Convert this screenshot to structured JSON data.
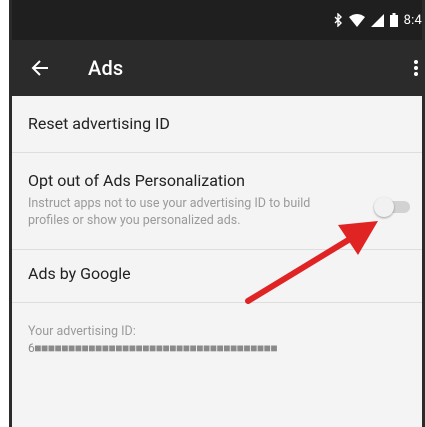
{
  "status_bar": {
    "time": "8:4",
    "icons": [
      "bluetooth-icon",
      "wifi-icon",
      "signal-icon",
      "battery-icon"
    ]
  },
  "app_bar": {
    "title": "Ads",
    "back_icon": "arrow-back-icon",
    "overflow_icon": "more-vert-icon"
  },
  "settings": {
    "reset_label": "Reset advertising ID",
    "opt_out_title": "Opt out of Ads Personalization",
    "opt_out_summary": "Instruct apps not to use your advertising ID to build profiles or show you personalized ads.",
    "opt_out_enabled": false,
    "ads_by_google_label": "Ads by Google",
    "advertising_id_label": "Your advertising ID:",
    "advertising_id_value": "6■■■■■■■■■■■■■■■■■■■■■■■■■■■■■■■■■■■■"
  },
  "colors": {
    "app_bar": "#2b2b2b",
    "status_bar": "#1f1f1f",
    "background": "#f4f4f4",
    "annotation_arrow": "#e02424"
  }
}
